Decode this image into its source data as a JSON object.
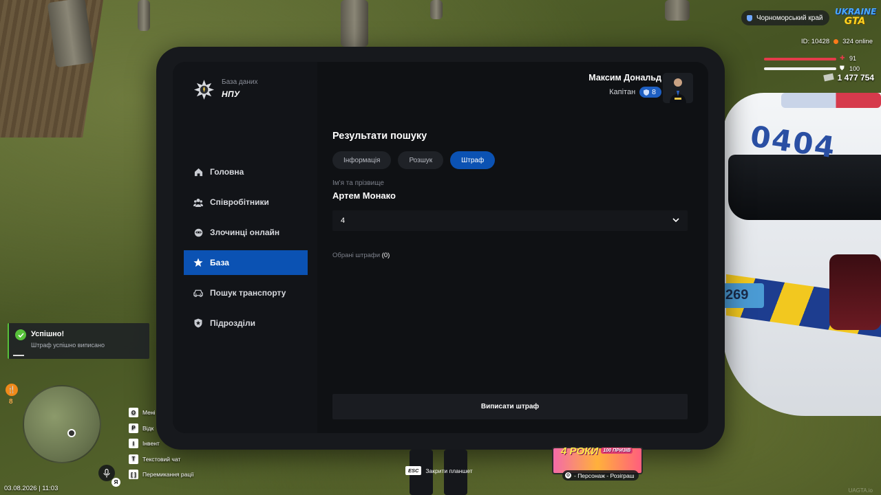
{
  "hud": {
    "region": "Чорноморський край",
    "logo_line1": "UKRAINE",
    "logo_line2": "GTA",
    "id_text": "ID: 10428",
    "online_text": "324 online",
    "health": "91",
    "armor": "100",
    "money": "1 477 754",
    "hunger": "8",
    "date_time": "03.08.2026 | 11:03",
    "lang": "Я"
  },
  "tablet": {
    "brand_small": "База даних",
    "brand_big": "НПУ",
    "user": {
      "name": "Максим Дональд",
      "rank": "Капітан",
      "level": "8"
    },
    "nav": [
      {
        "label": "Головна",
        "icon": "home-icon"
      },
      {
        "label": "Співробітники",
        "icon": "users-icon"
      },
      {
        "label": "Злочинці онлайн",
        "icon": "mask-icon"
      },
      {
        "label": "База",
        "icon": "star-icon",
        "active": true
      },
      {
        "label": "Пошук транспорту",
        "icon": "car-icon"
      },
      {
        "label": "Підрозділи",
        "icon": "shield-icon"
      }
    ],
    "section_title": "Результати пошуку",
    "tabs": [
      {
        "label": "Інформація"
      },
      {
        "label": "Розшук"
      },
      {
        "label": "Штраф",
        "active": true
      }
    ],
    "name_label": "Ім'я та прізвище",
    "name_value": "Артем Монако",
    "select_value": "4",
    "selected_fines_label": "Обрані штрафи",
    "selected_fines_count": "(0)",
    "submit_label": "Виписати штраф"
  },
  "notification": {
    "title": "Успішно!",
    "text": "Штраф успішно виписано"
  },
  "hints": [
    {
      "key": "O",
      "label": "Мені"
    },
    {
      "key": "P",
      "label": "Відк"
    },
    {
      "key": "I",
      "label": "Інвент"
    },
    {
      "key": "T",
      "label": "Текстовий чат"
    },
    {
      "key": "[   ]",
      "label": "Перемикання рації"
    }
  ],
  "esc_hint": {
    "key": "ESC",
    "label": "Закрити планшет"
  },
  "promo": {
    "title": "4 РОКИ",
    "sub": "100 ПРИЗІВ",
    "hint_key": "O",
    "hint_label": "- Персонаж - Розіграш"
  },
  "watermark": "UAGTA.io",
  "car": {
    "number": "0404",
    "plate": "269"
  }
}
